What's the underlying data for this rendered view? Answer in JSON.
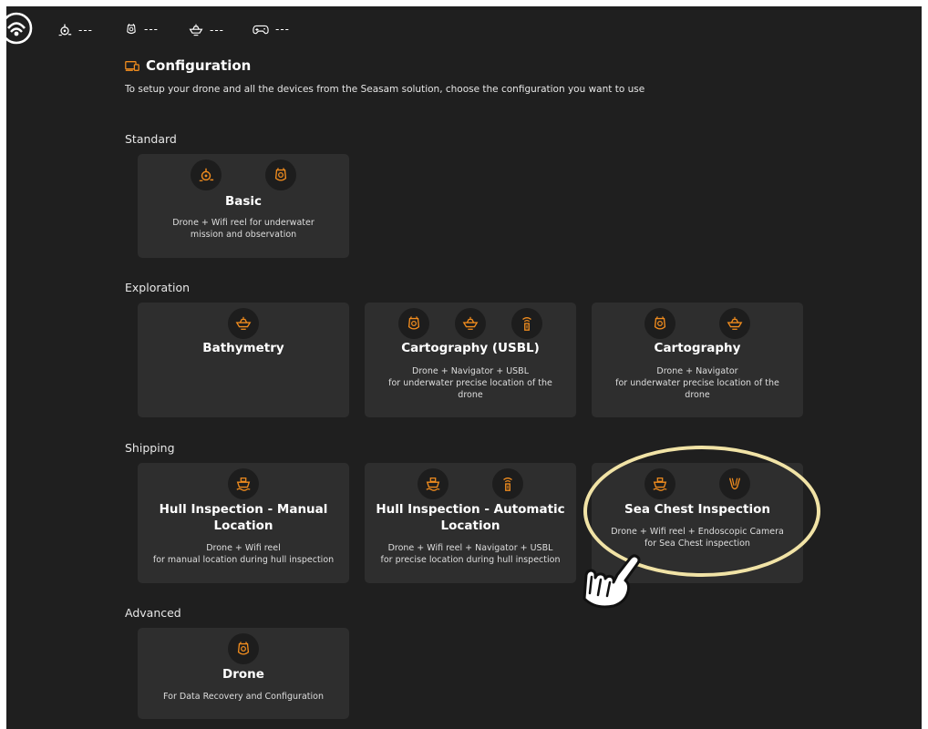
{
  "accent_color": "#f08c1e",
  "status_bar": {
    "items": [
      {
        "icon": "drone-icon",
        "value": "---"
      },
      {
        "icon": "reel-icon",
        "value": "---"
      },
      {
        "icon": "navigator-icon",
        "value": "---"
      },
      {
        "icon": "gamepad-icon",
        "value": "---"
      }
    ]
  },
  "header": {
    "icon": "configuration-icon",
    "title": "Configuration",
    "subtitle": "To setup your drone and all the devices from the Seasam solution, choose the configuration you want to use"
  },
  "sections": {
    "standard": {
      "label": "Standard",
      "cards": [
        {
          "title": "Basic",
          "icons": [
            "drone-icon",
            "reel-icon"
          ],
          "desc1": "Drone + Wifi reel for underwater",
          "desc2": "mission and observation"
        }
      ]
    },
    "exploration": {
      "label": "Exploration",
      "cards": [
        {
          "title": "Bathymetry",
          "icons": [
            "navigator-icon"
          ]
        },
        {
          "title": "Cartography (USBL)",
          "icons": [
            "reel-icon",
            "navigator-icon",
            "usbl-icon"
          ],
          "desc1": "Drone + Navigator + USBL",
          "desc2": "for underwater precise location of the",
          "desc3": "drone"
        },
        {
          "title": "Cartography",
          "icons": [
            "reel-icon",
            "navigator-icon"
          ],
          "desc1": "Drone + Navigator",
          "desc2": "for underwater precise location of the",
          "desc3": "drone"
        }
      ]
    },
    "shipping": {
      "label": "Shipping",
      "cards": [
        {
          "title1": "Hull Inspection - Manual",
          "title2": "Location",
          "icons": [
            "ship-icon"
          ],
          "desc1": "Drone + Wifi reel",
          "desc2": "for manual location during hull inspection"
        },
        {
          "title1": "Hull Inspection - Automatic",
          "title2": "Location",
          "icons": [
            "ship-icon",
            "usbl-icon"
          ],
          "desc1": "Drone + Wifi reel + Navigator + USBL",
          "desc2": "for precise location during hull inspection"
        },
        {
          "title": "Sea Chest Inspection",
          "icons": [
            "ship-icon",
            "endoscopic-camera-icon"
          ],
          "desc1": "Drone + Wifi reel + Endoscopic Camera",
          "desc2": "for Sea Chest inspection"
        }
      ]
    },
    "advanced": {
      "label": "Advanced",
      "cards": [
        {
          "title": "Drone",
          "icons": [
            "reel-icon"
          ],
          "desc1": "For Data Recovery and Configuration"
        }
      ]
    }
  }
}
